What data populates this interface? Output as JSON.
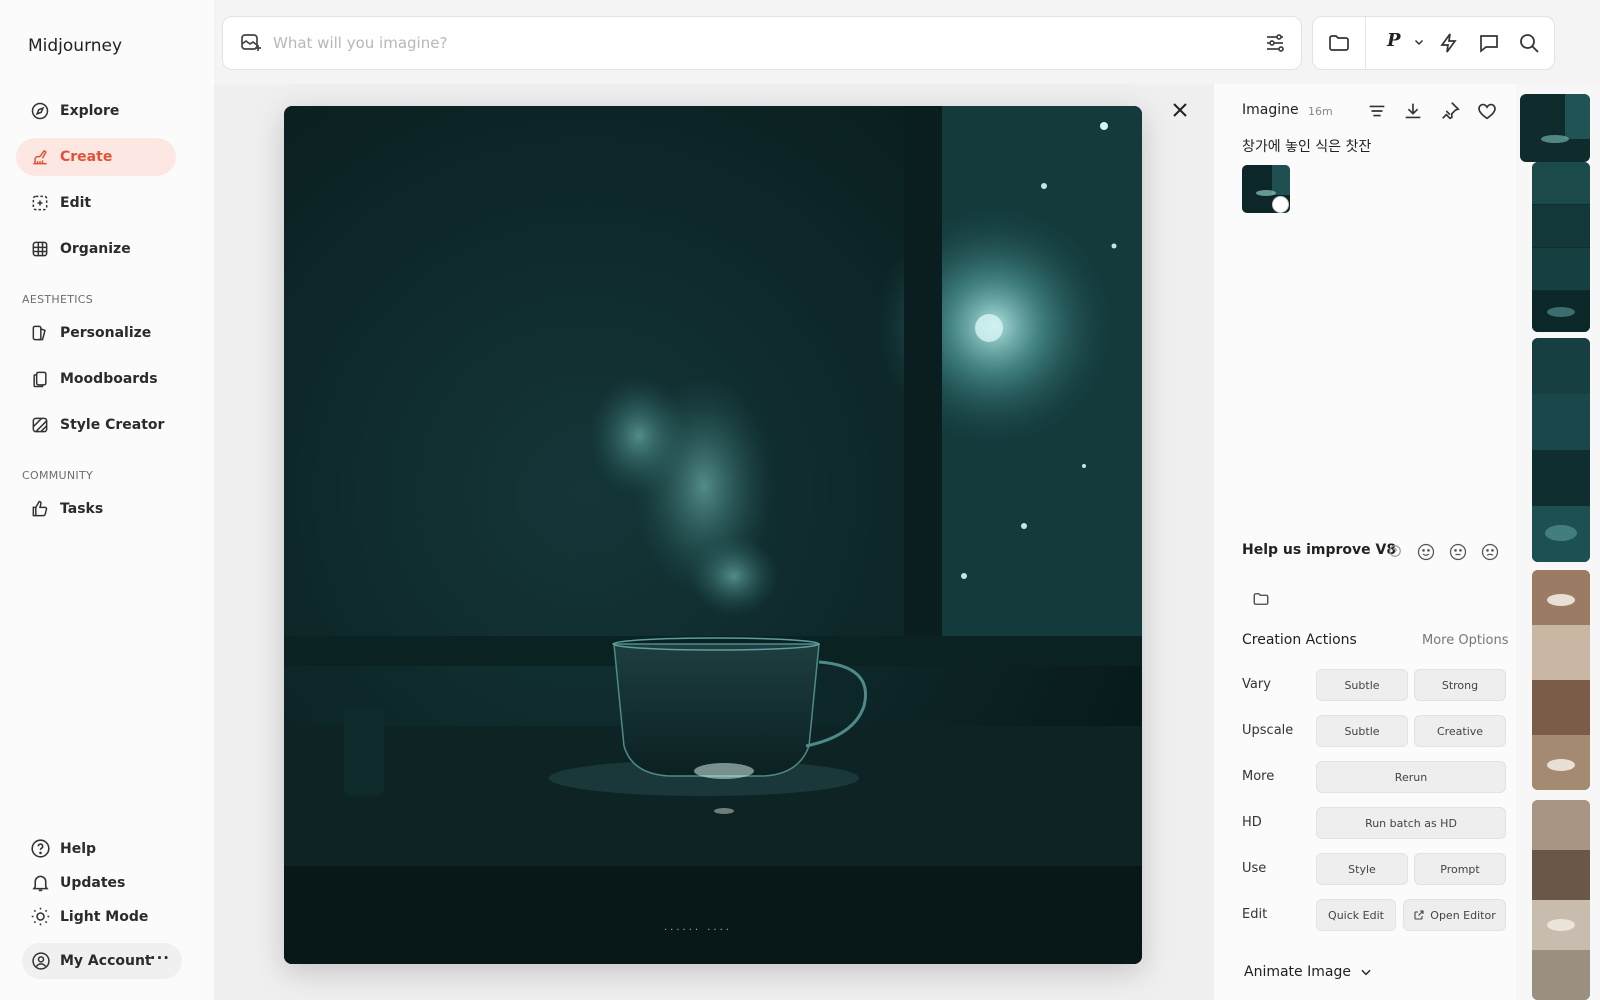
{
  "app": {
    "name": "Midjourney"
  },
  "sidebar": {
    "items": [
      {
        "label": "Explore",
        "icon": "compass-icon",
        "active": false
      },
      {
        "label": "Create",
        "icon": "brush-icon",
        "active": true
      },
      {
        "label": "Edit",
        "icon": "edit-frame-icon",
        "active": false
      },
      {
        "label": "Organize",
        "icon": "grid-icon",
        "active": false
      }
    ],
    "aesthetics_label": "AESTHETICS",
    "aesthetics_items": [
      {
        "label": "Personalize",
        "icon": "personalize-icon"
      },
      {
        "label": "Moodboards",
        "icon": "moodboard-icon"
      },
      {
        "label": "Style Creator",
        "icon": "style-creator-icon"
      }
    ],
    "community_label": "COMMUNITY",
    "community_items": [
      {
        "label": "Tasks",
        "icon": "thumbs-up-icon"
      }
    ],
    "footer": {
      "help": "Help",
      "updates": "Updates",
      "light_mode": "Light Mode",
      "account": "My Account",
      "account_more": "···"
    }
  },
  "search": {
    "placeholder": "What will you imagine?"
  },
  "toolbar": {
    "personalize_letter": "P"
  },
  "viewer": {
    "pager": "······ ····"
  },
  "panel": {
    "title": "Imagine",
    "time": "16m",
    "prompt": "창가에 놓인 식은 찻잔",
    "improve": "Help us improve V8",
    "creation_actions": "Creation Actions",
    "more_options": "More Options",
    "rows": {
      "vary": {
        "label": "Vary",
        "buttons": [
          "Subtle",
          "Strong"
        ]
      },
      "upscale": {
        "label": "Upscale",
        "buttons": [
          "Subtle",
          "Creative"
        ]
      },
      "more": {
        "label": "More",
        "buttons": [
          "Rerun"
        ]
      },
      "hd": {
        "label": "HD",
        "buttons": [
          "Run batch as HD"
        ]
      },
      "use": {
        "label": "Use",
        "buttons": [
          "Style",
          "Prompt"
        ]
      },
      "edit": {
        "label": "Edit",
        "buttons": [
          "Quick Edit",
          "Open Editor"
        ]
      }
    },
    "animate": "Animate Image"
  },
  "colors": {
    "accent": "#e0523a",
    "active_bg": "#fde7e3",
    "image_dark": "#0c2526",
    "image_teal": "#3a7a79"
  }
}
